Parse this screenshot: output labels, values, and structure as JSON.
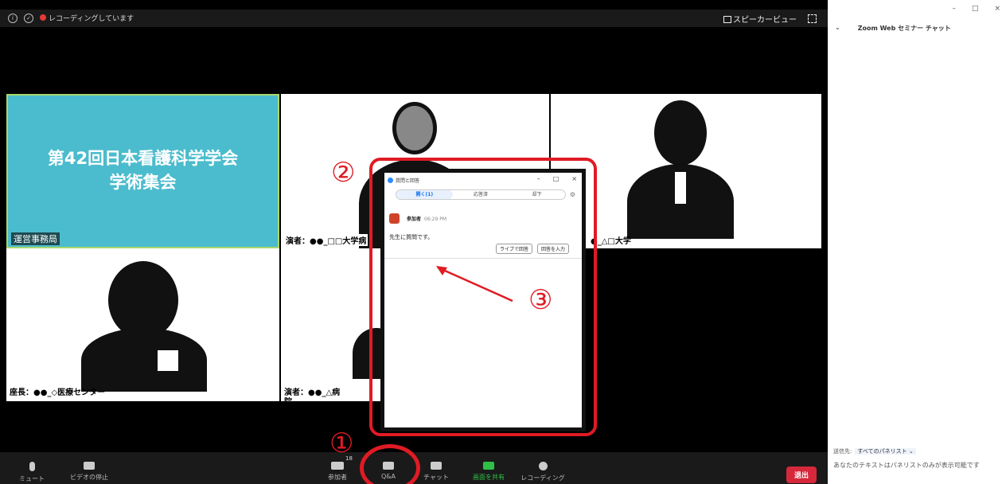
{
  "top_bar": {
    "recording_label": "レコーディングしています",
    "view_label": "スピーカービュー"
  },
  "tiles": {
    "host_title_line1": "第42回日本看護科学学会",
    "host_title_line2": "学術集会",
    "host_name": "運営事務局",
    "speaker1_name": "演者：●●_□□大学病",
    "speaker2_name": "●_△□大学",
    "chair_name": "座長：●●_◇医療センター",
    "speaker3_name": "演者：●●_△病",
    "speaker3_name2": "院"
  },
  "toolbar": {
    "mute": "ミュート",
    "video": "ビデオの停止",
    "participants": "参加者",
    "participants_count": "18",
    "qa": "Q&A",
    "chat": "チャット",
    "share": "画面を共有",
    "recording": "レコーディング",
    "leave": "退出"
  },
  "qa_window": {
    "title": "質問と回答",
    "tab_open": "開く(1)",
    "tab_answered": "応答済",
    "tab_dismissed": "却下",
    "author": "参加者",
    "time": "06:29 PM",
    "message": "先生に質問です。",
    "btn_live": "ライブで回答",
    "btn_type": "回答を入力"
  },
  "annotations": {
    "n1": "①",
    "n2": "②",
    "n3": "③"
  },
  "chat_panel": {
    "title": "Zoom Web セミナー チャット",
    "to_label": "送信先:",
    "to_value": "すべてのパネリスト ⌄",
    "note": "あなたのテキストはパネリストのみが表示可能です"
  },
  "colors": {
    "annotation_red": "#e01b24",
    "host_tile_bg": "#4bbccd",
    "leave_red": "#d6283b"
  }
}
